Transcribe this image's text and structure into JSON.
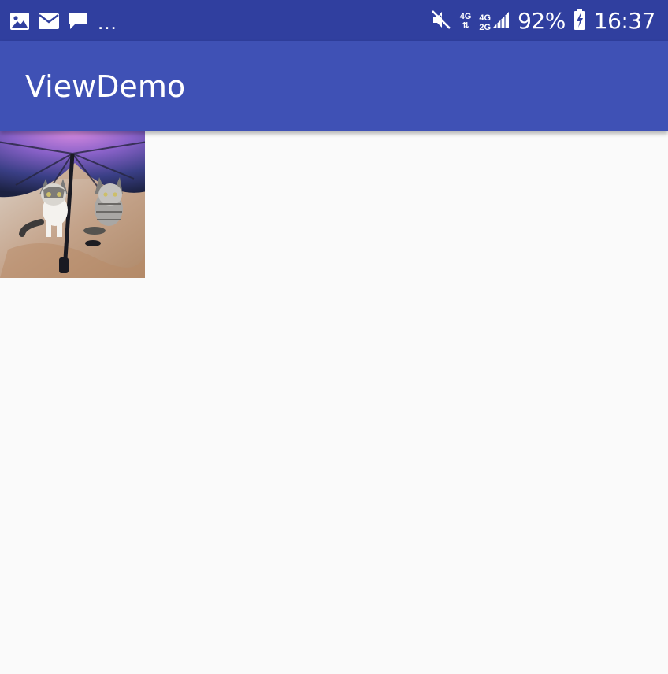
{
  "status_bar": {
    "notification_icons": [
      "image-icon",
      "email-icon",
      "chat-bubble-icon"
    ],
    "overflow": "...",
    "network_1": {
      "top": "4G",
      "bottom": "⇅"
    },
    "network_2": {
      "top": "4G",
      "bottom": "2G"
    },
    "battery_percent": "92%",
    "time": "16:37"
  },
  "app_bar": {
    "title": "ViewDemo"
  },
  "content": {
    "image_description_icon": "photo-cats-under-umbrella"
  },
  "colors": {
    "status_bar": "#303f9f",
    "app_bar": "#3f51b5",
    "background": "#fafafa"
  }
}
